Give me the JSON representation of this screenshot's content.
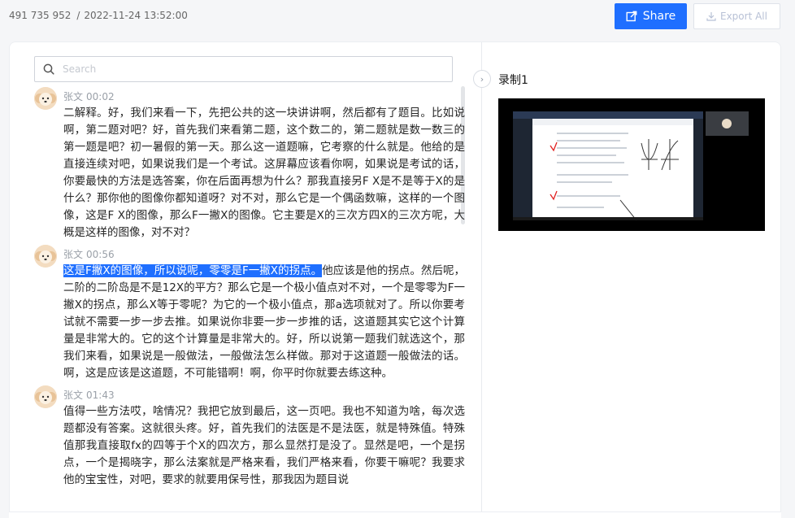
{
  "header": {
    "meeting_id": "491 735 952",
    "datetime": "2022-11-24 13:52:00",
    "share_label": "Share",
    "export_label": "Export All",
    "accent_color": "#1f6fff"
  },
  "search": {
    "placeholder": "Search",
    "icon": "search-icon"
  },
  "transcript": [
    {
      "speaker": "张文",
      "time": "00:02",
      "text": "二解释。好，我们来看一下，先把公共的这一块讲讲啊，然后都有了题目。比如说啊，第二题对吧？好，首先我们来看第二题，这个数二的，第二题就是数一数三的第一题是吧？初一暑假的第一天。那么这一道题嘛，它考察的什么就是。他给的是直接连续对吧，如果说我们是一个考试。这屏幕应该看你啊，如果说是考试的话，你要最快的方法是选答案，你在后面再想为什么？那我直接另F X是不是等于X的是什么？那你他的图像你都知道呀？对不对，那么它是一个偶函数嘛，这样的一个图像，这是F X的图像，那么F一撇X的图像。它主要是X的三次方四X的三次方呢，大概是这样的图像，对不对？"
    },
    {
      "speaker": "张文",
      "time": "00:56",
      "highlight": "这是F撇X的图像，所以说呢，零零是F一撇X的拐点。",
      "text": "他应该是他的拐点。然后呢，二阶的二阶岛是不是12X的平方？那么它是一个极小值点对不对，一个是零零为F一撇X的拐点，那么X等于零呢？为它的一个极小值点，那a选项就对了。所以你要考试就不需要一步一步去推。如果说你非要一步一步推的话，这道题其实它这个计算量是非常大的。它的这个计算量是非常大的。好，所以说第一题我们就选这个，那我们来看，如果说是一般做法，一般做法怎么样做。那对于这道题一般做法的话。啊，这是应该是这道题，不可能错啊！啊，你平时你就要去练这种。"
    },
    {
      "speaker": "张文",
      "time": "01:43",
      "text": "值得一些方法哎，啥情况？我把它放到最后，这一页吧。我也不知道为啥，每次选题都没有答案。这就很头疼。好，首先我们的法医是不是法医，就是特殊值。特殊值那我直接取fx的四等于个X的四次方，那么显然打是没了。显然是吧，一个是拐点，一个是揭晓字，那么法案就是严格来看，我们严格来看，你要干嘛呢？我要求他的宝宝性，对吧，要求的就要用保号性，那我因为题目说"
    }
  ],
  "recording": {
    "title": "录制1"
  }
}
